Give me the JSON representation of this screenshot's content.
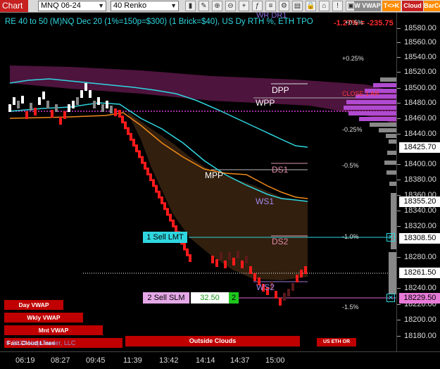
{
  "toolbar": {
    "chart_label": "Chart",
    "instrument": "MNQ 06-24",
    "bar_type": "40 Renko",
    "vwap_label": "W VWAP",
    "tk_label": "T<>K",
    "cloud_label": "Cloud",
    "barco_label": "BarCo"
  },
  "title": "RE 40 to 50 (M)NQ Dec 20 (1%=150p=$300) (1 Brick=$40), US Dy RTH %, ETH TPO",
  "pnl_text": "-1.27% = -235.75",
  "price_axis": {
    "labels": [
      "18580.00",
      "18560.00",
      "18540.00",
      "18520.00",
      "18500.00",
      "18480.00",
      "18460.00",
      "18440.00",
      "18400.00",
      "18380.00",
      "18360.00",
      "18340.00",
      "18320.00",
      "18280.00",
      "18240.00",
      "18220.00",
      "18200.00",
      "18180.00"
    ],
    "tags": [
      {
        "text": "18425.70",
        "bg": "#ffffff",
        "fg": "#000000"
      },
      {
        "text": "18355.20",
        "bg": "#ffffff",
        "fg": "#000000"
      },
      {
        "text": "18308.50",
        "bg": "#ffffff",
        "fg": "#000000"
      },
      {
        "text": "18261.50",
        "bg": "#ffffff",
        "fg": "#000000"
      },
      {
        "text": "18229.50",
        "bg": "#e87ad8",
        "fg": "#000000"
      }
    ]
  },
  "time_axis": [
    "06:19",
    "08:27",
    "09:45",
    "11:39",
    "13:42",
    "14:14",
    "14:37",
    "15:00"
  ],
  "levels": {
    "wr_dr1": "WR DR1",
    "dpp": "DPP",
    "wpp": "WPP",
    "mpp": "MPP",
    "ds1": "DS1",
    "ws1": "WS1",
    "ds2": "DS2",
    "ws2": "WS2",
    "close_1_ar": "CLOSE 1 AR",
    "pct_p05": "+0.5%",
    "pct_p025": "+0.25%",
    "pct_m025": "-0.25%",
    "pct_m05": "-0.5%",
    "pct_m10": "-1.0%",
    "pct_m15": "-1.5%"
  },
  "orders": {
    "sell_lmt": "1 Sell LMT",
    "sell_slm": "2 Sell SLM",
    "slm_price": "32.50",
    "slm_qty": "2"
  },
  "buttons": {
    "day_vwap": "Day VWAP",
    "wkly_vwap": "Wkly VWAP",
    "mnt_vwap": "Mnt VWAP",
    "outside_clouds": "Outside Clouds",
    "us_eth_or": "US ETH OR"
  },
  "watermark": "© 2024 NinjaTrader, LLC",
  "overlay_text": "Fast Cloud Lines",
  "colors": {
    "accent_cyan": "#2fd6e0",
    "cloud_magenta": "#6a1a55",
    "brick_red": "#ff1a1a",
    "brick_white": "#ffffff",
    "loss_red": "#ff2a2a"
  }
}
